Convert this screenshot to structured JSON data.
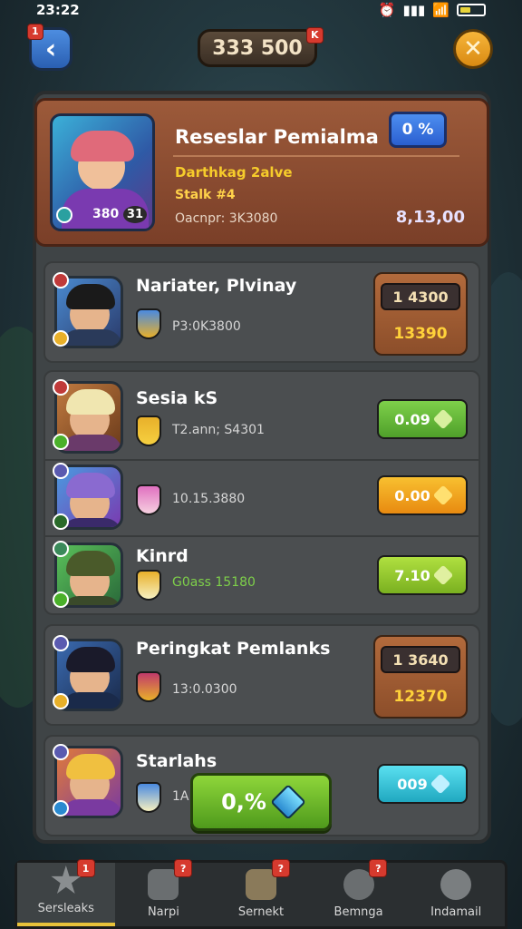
{
  "status_bar": {
    "time": "23:22",
    "battery_level": 0.45
  },
  "top_bar": {
    "back_badge": "1",
    "currency": "333 500",
    "currency_badge": "K"
  },
  "featured": {
    "title": "Reseslar Pemialma",
    "subtitle": "Darthkag 2alve",
    "stat": "Stalk #4",
    "info": "Oacnpr: 3K3080",
    "score": "8,13,00",
    "button": "0 %",
    "portrait_level": "380",
    "portrait_tag": "31"
  },
  "rows": [
    {
      "name": "Nariater, Plvinay",
      "stat": "P3:0K3800",
      "value_top": "1 4300",
      "value_bottom": "13390",
      "kind": "box"
    },
    {
      "name": "Sesia kS",
      "stat": "T2.ann; S4301",
      "pill": "0.09",
      "pill_color": "green",
      "kind": "pill"
    },
    {
      "name": "",
      "stat": "10.15.3880",
      "pill": "0.00",
      "pill_color": "orange",
      "kind": "pill"
    },
    {
      "name": "Kinrd",
      "stat": "G0ass 15180",
      "pill": "7.10",
      "pill_color": "lime",
      "kind": "pill"
    },
    {
      "name": "Peringkat Pemlanks",
      "stat": "13:0.0300",
      "value_top": "1 3640",
      "value_bottom": "12370",
      "kind": "box"
    },
    {
      "name": "Starlahs",
      "stat": "1A",
      "pill": "009",
      "pill_color": "cyan",
      "kind": "pill"
    }
  ],
  "float_button": {
    "label": "0,%"
  },
  "nav": [
    {
      "label": "Sersleaks",
      "badge": "1",
      "icon": "star-icon",
      "active": true
    },
    {
      "label": "Narpi",
      "badge": "?",
      "icon": "box-icon",
      "active": false
    },
    {
      "label": "Sernekt",
      "badge": "?",
      "icon": "chest-icon",
      "active": false
    },
    {
      "label": "Bemnga",
      "badge": "?",
      "icon": "shield-icon",
      "active": false
    },
    {
      "label": "Indamail",
      "badge": "",
      "icon": "gear-icon",
      "active": false
    }
  ],
  "colors": {
    "accent": "#e8c23a",
    "green": "#5cc02a",
    "orange": "#f0a020",
    "cyan": "#3ac8d8",
    "panel": "#3f4446"
  }
}
